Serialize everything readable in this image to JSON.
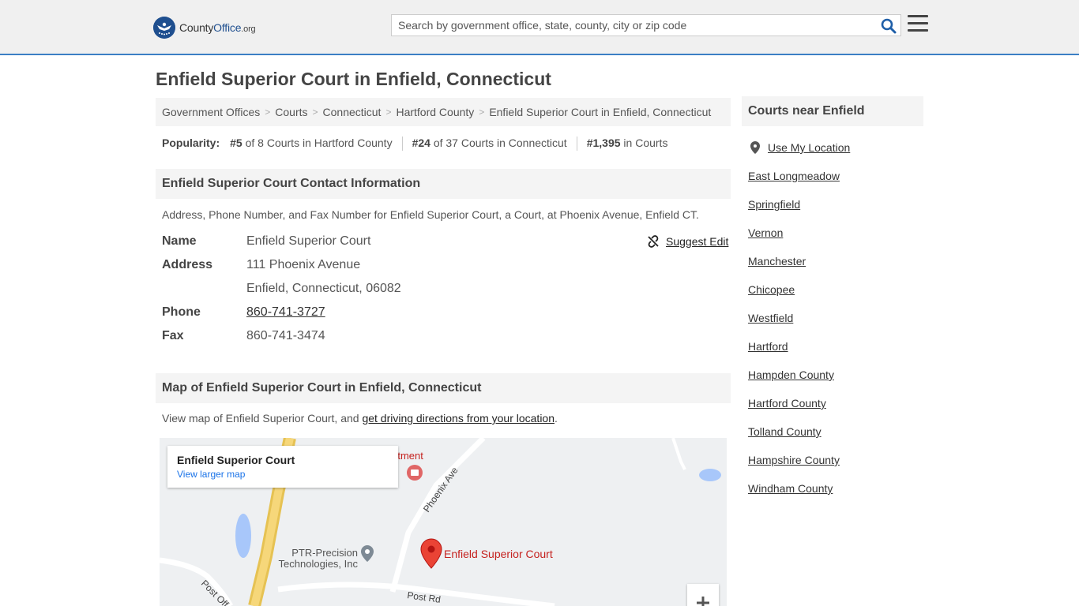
{
  "header": {
    "logo_prefix": "County",
    "logo_brand": "Office",
    "logo_suffix": ".org",
    "search_placeholder": "Search by government office, state, county, city or zip code",
    "search_icon": "search-icon",
    "menu_icon": "hamburger-menu-icon",
    "accent_color": "#3b7fc4"
  },
  "page_title": "Enfield Superior Court in Enfield, Connecticut",
  "breadcrumb": [
    {
      "label": "Government Offices"
    },
    {
      "label": "Courts"
    },
    {
      "label": "Connecticut"
    },
    {
      "label": "Hartford County"
    },
    {
      "label": "Enfield Superior Court in Enfield, Connecticut"
    }
  ],
  "popularity": {
    "label": "Popularity:",
    "items": [
      {
        "rank": "#5",
        "text": " of 8 Courts in Hartford County"
      },
      {
        "rank": "#24",
        "text": " of 37 Courts in Connecticut"
      },
      {
        "rank": "#1,395",
        "text": " in Courts"
      }
    ]
  },
  "contact": {
    "heading": "Enfield Superior Court Contact Information",
    "description": "Address, Phone Number, and Fax Number for Enfield Superior Court, a Court, at Phoenix Avenue, Enfield CT.",
    "suggest_edit": "Suggest Edit",
    "fields": {
      "name_label": "Name",
      "name_value": "Enfield Superior Court",
      "address_label": "Address",
      "address_line1": "111 Phoenix Avenue",
      "address_line2": "Enfield, Connecticut, 06082",
      "phone_label": "Phone",
      "phone_value": "860-741-3727",
      "fax_label": "Fax",
      "fax_value": "860-741-3474"
    }
  },
  "map_section": {
    "heading": "Map of Enfield Superior Court in Enfield, Connecticut",
    "desc_prefix": "View map of Enfield Superior Court, and ",
    "desc_link": "get driving directions from your location",
    "desc_suffix": ".",
    "card_title": "Enfield Superior Court",
    "card_link": "View larger map",
    "pin_label": "Enfield Superior Court",
    "poi_label_line1": "PTR-Precision",
    "poi_label_line2": "Technologies, Inc",
    "poi_top_label": "rtment",
    "road_phoenix": "Phoenix Ave",
    "road_post": "Post Rd",
    "road_post_off": "Post Off",
    "zoom_in": "+"
  },
  "sidebar": {
    "heading": "Courts near Enfield",
    "use_location": "Use My Location",
    "items": [
      "East Longmeadow",
      "Springfield",
      "Vernon",
      "Manchester",
      "Chicopee",
      "Westfield",
      "Hartford",
      "Hampden County",
      "Hartford County",
      "Tolland County",
      "Hampshire County",
      "Windham County"
    ]
  }
}
